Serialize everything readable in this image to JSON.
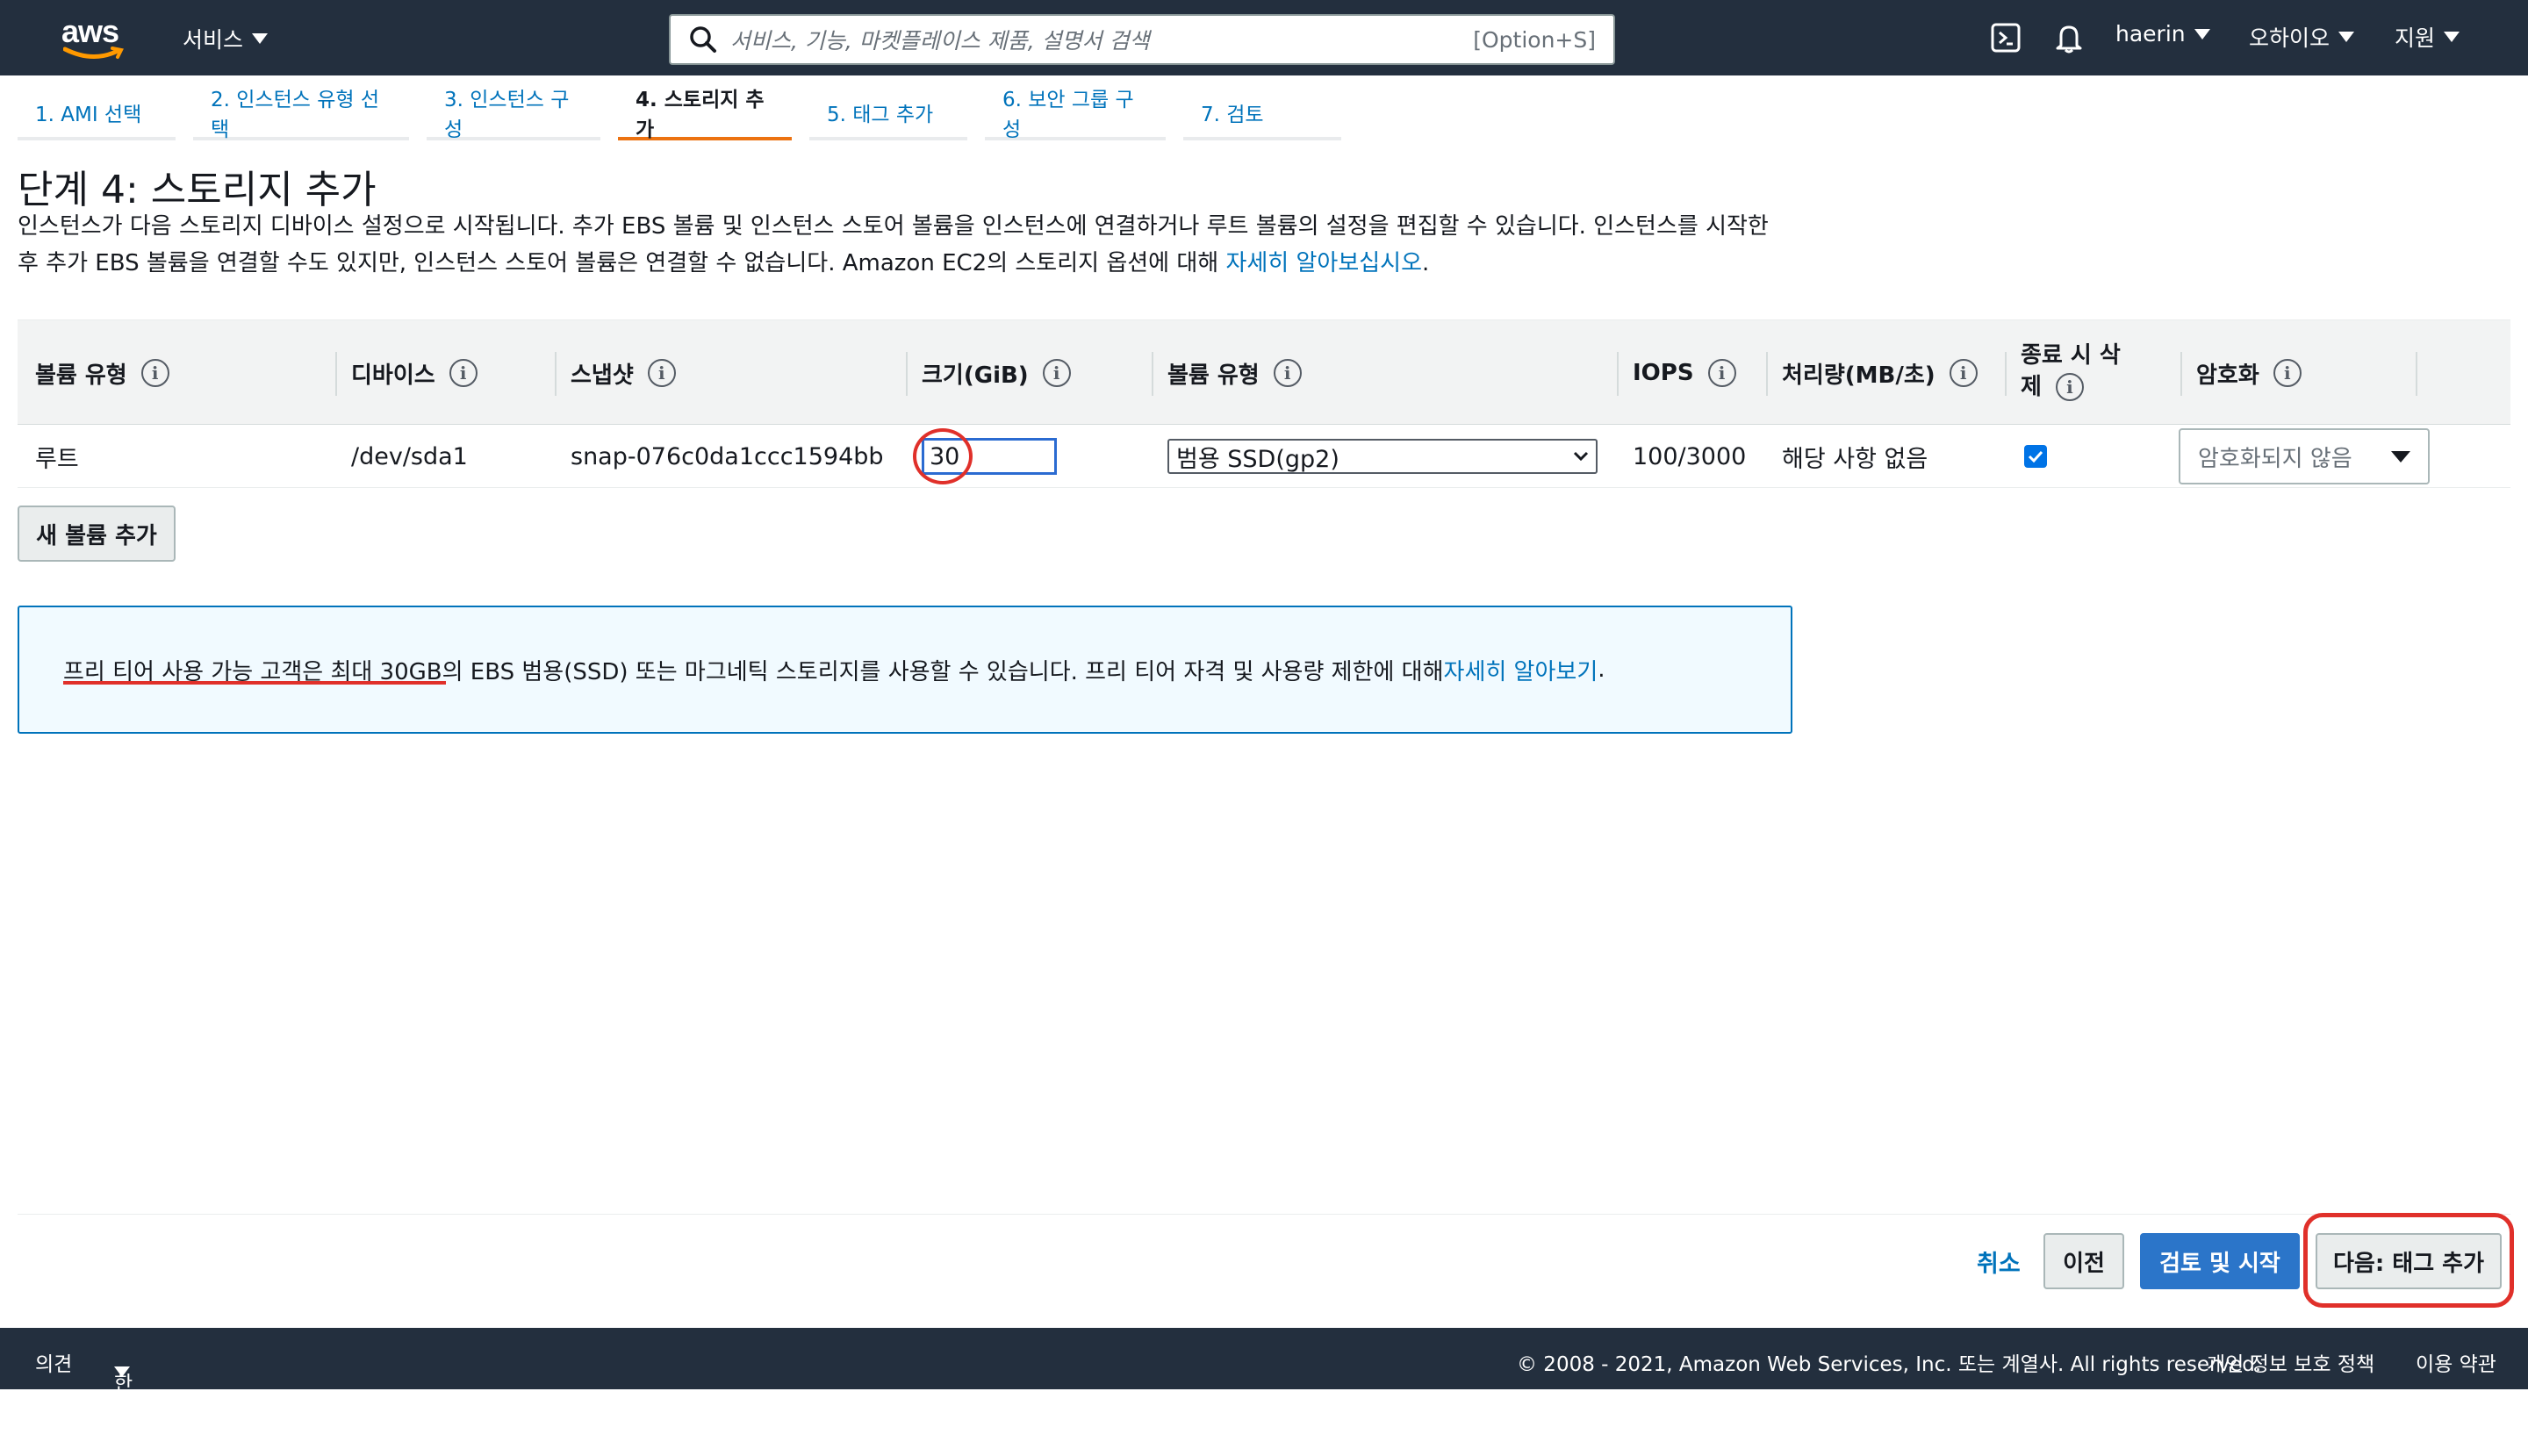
{
  "nav": {
    "logo": "aws",
    "services": "서비스",
    "search_placeholder": "서비스, 기능, 마켓플레이스 제품, 설명서 검색",
    "search_shortcut": "[Option+S]",
    "user": "haerin",
    "region": "오하이오",
    "support": "지원"
  },
  "steps": [
    {
      "label": "1. AMI 선택"
    },
    {
      "label": "2. 인스턴스 유형 선택"
    },
    {
      "label": "3. 인스턴스 구성"
    },
    {
      "label": "4. 스토리지 추가"
    },
    {
      "label": "5. 태그 추가"
    },
    {
      "label": "6. 보안 그룹 구성"
    },
    {
      "label": "7. 검토"
    }
  ],
  "page": {
    "title": "단계 4: 스토리지 추가",
    "description_1": "인스턴스가 다음 스토리지 디바이스 설정으로 시작됩니다. 추가 EBS 볼륨 및 인스턴스 스토어 볼륨을 인스턴스에 연결하거나 루트 볼륨의 설정을 편집할 수 있습니다. 인스턴스를 시작한",
    "description_2": "후 추가 EBS 볼륨을 연결할 수도 있지만, 인스턴스 스토어 볼륨은 연결할 수 없습니다. Amazon EC2의 스토리지 옵션에 대해 ",
    "description_link": "자세히 알아보십시오",
    "description_end": "."
  },
  "table": {
    "headers": {
      "volume_type": "볼륨 유형",
      "device": "디바이스",
      "snapshot": "스냅샷",
      "size": "크기(GiB)",
      "ebs_type": "볼륨 유형",
      "iops": "IOPS",
      "throughput": "처리량(MB/초)",
      "delete_on_term_1": "종료 시 삭",
      "delete_on_term_2": "제",
      "encryption": "암호화"
    },
    "row": {
      "volume_type": "루트",
      "device": "/dev/sda1",
      "snapshot": "snap-076c0da1ccc1594bb",
      "size": "30",
      "ebs_type": "범용 SSD(gp2)",
      "iops": "100/3000",
      "throughput": "해당 사항 없음",
      "delete_on_termination": true,
      "encryption": "암호화되지 않음"
    }
  },
  "add_volume_button": "새 볼륨 추가",
  "info": {
    "text_underlined": "프리 티어 사용 가능 고객은 최대 30GB",
    "text_rest": "의 EBS 범용(SSD) 또는 마그네틱 스토리지를 사용할 수 있습니다. 프리 티어 자격 및 사용량 제한에 대해 ",
    "link": "자세히 알아보기",
    "end": "."
  },
  "actions": {
    "cancel": "취소",
    "previous": "이전",
    "review_launch": "검토 및 시작",
    "next": "다음: 태그 추가"
  },
  "footer": {
    "feedback": "의견",
    "language": "한국어",
    "copyright": "© 2008 - 2021, Amazon Web Services, Inc. 또는 계열사. All rights reserved.",
    "privacy": "개인 정보 보호 정책",
    "terms": "이용 약관"
  },
  "colors": {
    "nav_bg": "#232f3e",
    "accent_orange": "#ec7211",
    "link_blue": "#0073bb",
    "primary_button": "#2b75c9",
    "annotation_red": "#e0302a"
  }
}
